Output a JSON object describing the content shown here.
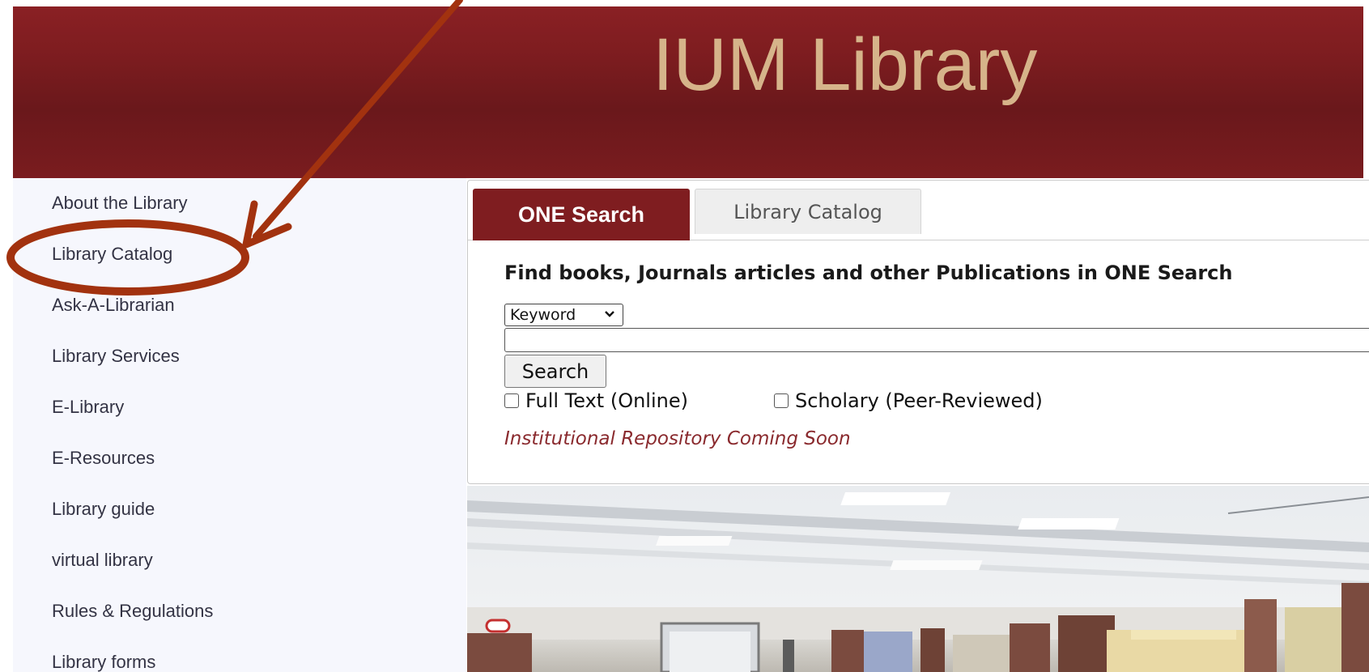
{
  "header": {
    "title": "IUM Library"
  },
  "sidebar": {
    "items": [
      {
        "label": "About the Library"
      },
      {
        "label": "Library Catalog"
      },
      {
        "label": "Ask-A-Librarian"
      },
      {
        "label": "Library Services"
      },
      {
        "label": "E-Library"
      },
      {
        "label": "E-Resources"
      },
      {
        "label": "Library guide"
      },
      {
        "label": "virtual library"
      },
      {
        "label": "Rules & Regulations"
      },
      {
        "label": "Library forms"
      }
    ]
  },
  "search_panel": {
    "tabs": [
      {
        "label": "ONE Search",
        "active": true
      },
      {
        "label": "Library Catalog",
        "active": false
      }
    ],
    "heading": "Find books, Journals articles and other Publications in ONE Search",
    "search_type": {
      "selected": "Keyword"
    },
    "query": {
      "value": "",
      "placeholder": ""
    },
    "search_button_label": "Search",
    "filters": [
      {
        "label": "Full Text (Online)",
        "checked": false
      },
      {
        "label": "Scholary (Peer-Reviewed)",
        "checked": false
      }
    ],
    "repository_note": "Institutional Repository Coming Soon"
  },
  "colors": {
    "brand": "#7f1d20",
    "header_text": "#d6b48a",
    "sidebar_bg": "#f6f7fd",
    "annotation": "#a2320f"
  }
}
